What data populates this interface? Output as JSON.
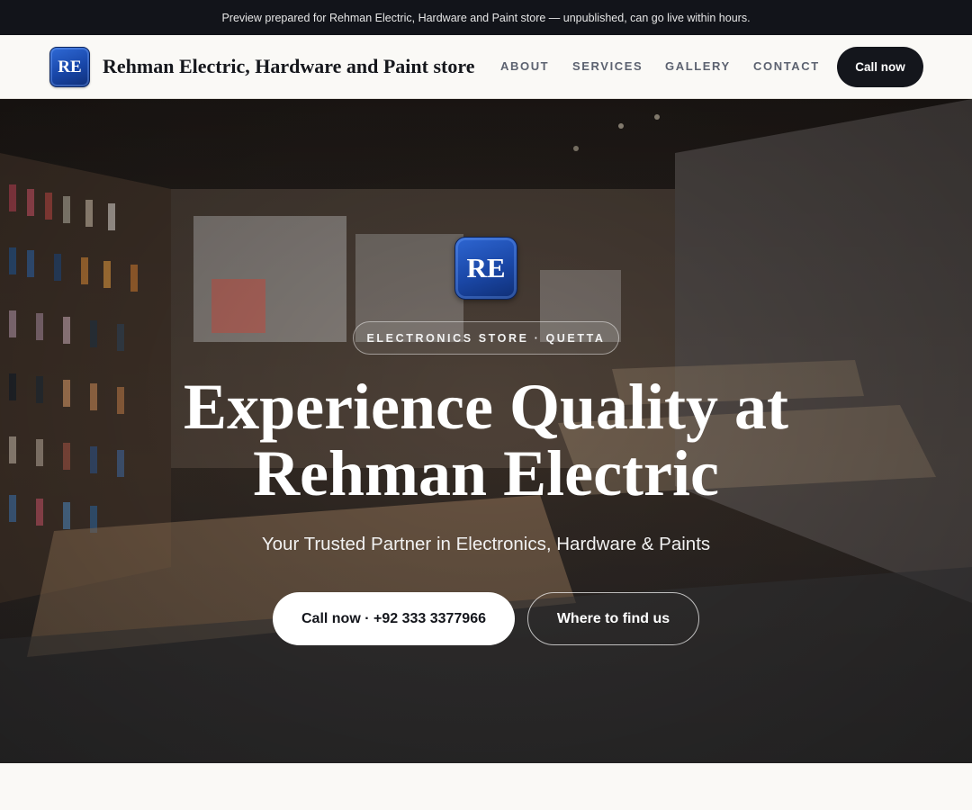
{
  "preview_bar": {
    "text": "Preview prepared for Rehman Electric, Hardware and Paint store — unpublished, can go live within hours."
  },
  "header": {
    "logo_text": "RE",
    "brand_name": "Rehman Electric, Hardware and Paint store",
    "nav": [
      "ABOUT",
      "SERVICES",
      "GALLERY",
      "CONTACT"
    ],
    "cta_label": "Call now"
  },
  "hero": {
    "logo_text": "RE",
    "tag": "ELECTRONICS STORE · QUETTA",
    "title_line1": "Experience Quality at",
    "title_line2": "Rehman Electric",
    "subtitle": "Your Trusted Partner in Electronics, Hardware & Paints",
    "primary_button": "Call now · +92 333 3377966",
    "secondary_button": "Where to find us"
  },
  "colors": {
    "top_bar": "#12141a",
    "header_bg": "#faf9f6",
    "logo_blue": "#1846a8",
    "dark_button": "#14161c"
  }
}
